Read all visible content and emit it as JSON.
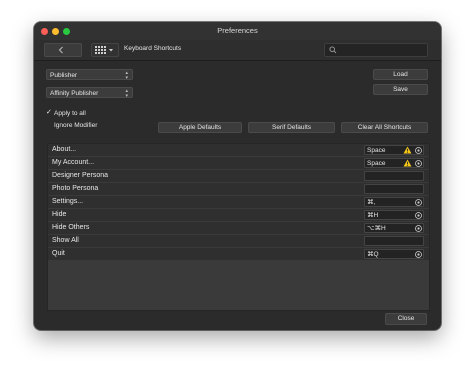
{
  "window": {
    "title": "Preferences"
  },
  "toolbar": {
    "section_label": "Keyboard Shortcuts",
    "search_placeholder": ""
  },
  "selectors": {
    "app": "Publisher",
    "persona": "Affinity Publisher"
  },
  "buttons": {
    "load": "Load",
    "save": "Save",
    "apple_defaults": "Apple Defaults",
    "serif_defaults": "Serif Defaults",
    "clear_all": "Clear All Shortcuts",
    "close": "Close"
  },
  "options": {
    "apply_to_all": {
      "label": "Apply to all",
      "checked": true
    },
    "ignore_modifier": {
      "label": "Ignore Modifier",
      "checked": false
    }
  },
  "shortcuts": [
    {
      "name": "About...",
      "key": "Space",
      "warning": true,
      "clearable": true
    },
    {
      "name": "My Account...",
      "key": "Space",
      "warning": true,
      "clearable": true
    },
    {
      "name": "Designer Persona",
      "key": "",
      "warning": false,
      "clearable": false
    },
    {
      "name": "Photo Persona",
      "key": "",
      "warning": false,
      "clearable": false
    },
    {
      "name": "Settings...",
      "key": "⌘,",
      "warning": false,
      "clearable": true
    },
    {
      "name": "Hide",
      "key": "⌘H",
      "warning": false,
      "clearable": true
    },
    {
      "name": "Hide Others",
      "key": "⌥⌘H",
      "warning": false,
      "clearable": true
    },
    {
      "name": "Show All",
      "key": "",
      "warning": false,
      "clearable": false
    },
    {
      "name": "Quit",
      "key": "⌘Q",
      "warning": false,
      "clearable": true
    }
  ],
  "colors": {
    "warning": "#f5c518",
    "window_bg": "#2b2b2b",
    "row_bg": "#2f2f2f"
  }
}
